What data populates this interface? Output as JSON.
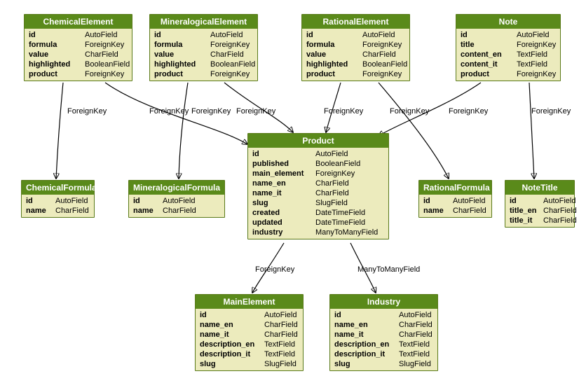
{
  "entities": {
    "ChemicalElement": {
      "title": "ChemicalElement",
      "fields": [
        {
          "name": "id",
          "type": "AutoField"
        },
        {
          "name": "formula",
          "type": "ForeignKey"
        },
        {
          "name": "value",
          "type": "CharField"
        },
        {
          "name": "highlighted",
          "type": "BooleanField"
        },
        {
          "name": "product",
          "type": "ForeignKey"
        }
      ]
    },
    "MineralogicalElement": {
      "title": "MineralogicalElement",
      "fields": [
        {
          "name": "id",
          "type": "AutoField"
        },
        {
          "name": "formula",
          "type": "ForeignKey"
        },
        {
          "name": "value",
          "type": "CharField"
        },
        {
          "name": "highlighted",
          "type": "BooleanField"
        },
        {
          "name": "product",
          "type": "ForeignKey"
        }
      ]
    },
    "RationalElement": {
      "title": "RationalElement",
      "fields": [
        {
          "name": "id",
          "type": "AutoField"
        },
        {
          "name": "formula",
          "type": "ForeignKey"
        },
        {
          "name": "value",
          "type": "CharField"
        },
        {
          "name": "highlighted",
          "type": "BooleanField"
        },
        {
          "name": "product",
          "type": "ForeignKey"
        }
      ]
    },
    "Note": {
      "title": "Note",
      "fields": [
        {
          "name": "id",
          "type": "AutoField"
        },
        {
          "name": "title",
          "type": "ForeignKey"
        },
        {
          "name": "content_en",
          "type": "TextField"
        },
        {
          "name": "content_it",
          "type": "TextField"
        },
        {
          "name": "product",
          "type": "ForeignKey"
        }
      ]
    },
    "Product": {
      "title": "Product",
      "fields": [
        {
          "name": "id",
          "type": "AutoField"
        },
        {
          "name": "published",
          "type": "BooleanField"
        },
        {
          "name": "main_element",
          "type": "ForeignKey"
        },
        {
          "name": "name_en",
          "type": "CharField"
        },
        {
          "name": "name_it",
          "type": "CharField"
        },
        {
          "name": "slug",
          "type": "SlugField"
        },
        {
          "name": "created",
          "type": "DateTimeField"
        },
        {
          "name": "updated",
          "type": "DateTimeField"
        },
        {
          "name": "industry",
          "type": "ManyToManyField"
        }
      ]
    },
    "ChemicalFormula": {
      "title": "ChemicalFormula",
      "fields": [
        {
          "name": "id",
          "type": "AutoField"
        },
        {
          "name": "name",
          "type": "CharField"
        }
      ]
    },
    "MineralogicalFormula": {
      "title": "MineralogicalFormula",
      "fields": [
        {
          "name": "id",
          "type": "AutoField"
        },
        {
          "name": "name",
          "type": "CharField"
        }
      ]
    },
    "RationalFormula": {
      "title": "RationalFormula",
      "fields": [
        {
          "name": "id",
          "type": "AutoField"
        },
        {
          "name": "name",
          "type": "CharField"
        }
      ]
    },
    "NoteTitle": {
      "title": "NoteTitle",
      "fields": [
        {
          "name": "id",
          "type": "AutoField"
        },
        {
          "name": "title_en",
          "type": "CharField"
        },
        {
          "name": "title_it",
          "type": "CharField"
        }
      ]
    },
    "MainElement": {
      "title": "MainElement",
      "fields": [
        {
          "name": "id",
          "type": "AutoField"
        },
        {
          "name": "name_en",
          "type": "CharField"
        },
        {
          "name": "name_it",
          "type": "CharField"
        },
        {
          "name": "description_en",
          "type": "TextField"
        },
        {
          "name": "description_it",
          "type": "TextField"
        },
        {
          "name": "slug",
          "type": "SlugField"
        }
      ]
    },
    "Industry": {
      "title": "Industry",
      "fields": [
        {
          "name": "id",
          "type": "AutoField"
        },
        {
          "name": "name_en",
          "type": "CharField"
        },
        {
          "name": "name_it",
          "type": "CharField"
        },
        {
          "name": "description_en",
          "type": "TextField"
        },
        {
          "name": "description_it",
          "type": "TextField"
        },
        {
          "name": "slug",
          "type": "SlugField"
        }
      ]
    }
  },
  "edgeLabels": {
    "fk": "ForeignKey",
    "m2m": "ManyToManyField"
  }
}
